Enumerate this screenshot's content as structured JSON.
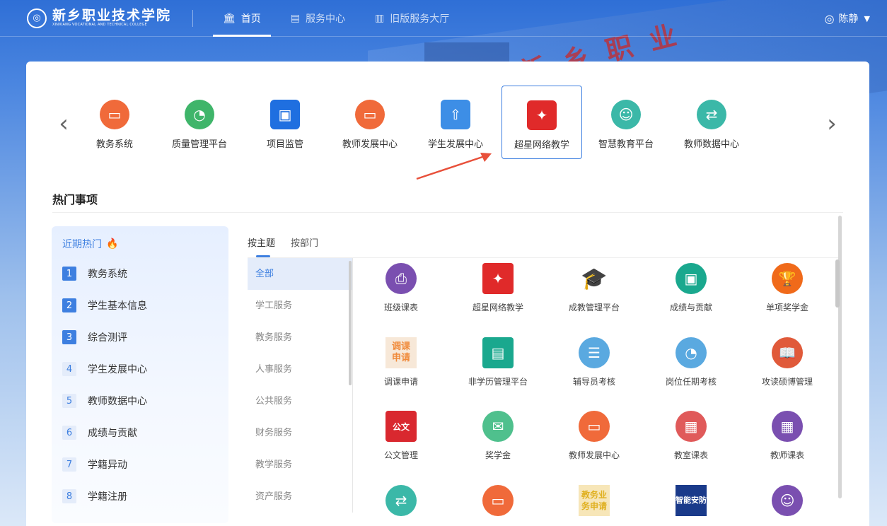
{
  "header": {
    "logo_cn": "新乡职业技术学院",
    "logo_en": "XINXIANG VOCATIONAL AND TECHNICAL COLLEGE",
    "nav": [
      {
        "label": "首页",
        "icon": "bank-icon"
      },
      {
        "label": "服务中心",
        "icon": "service-icon"
      },
      {
        "label": "旧版服务大厅",
        "icon": "document-icon"
      }
    ],
    "user_name": "陈静"
  },
  "background": {
    "sign_text": "新 乡 职 业"
  },
  "apps": [
    {
      "label": "教务系统",
      "color": "#f06a3a"
    },
    {
      "label": "质量管理平台",
      "color": "#3fb56a"
    },
    {
      "label": "项目监管",
      "color": "#1f6fe0"
    },
    {
      "label": "教师发展中心",
      "color": "#f06a3a"
    },
    {
      "label": "学生发展中心",
      "color": "#3d8ee6"
    },
    {
      "label": "超星网络教学",
      "color": "#e02a2a"
    },
    {
      "label": "智慧教育平台",
      "color": "#3bb8a8"
    },
    {
      "label": "教师数据中心",
      "color": "#3bb8a8"
    }
  ],
  "section_title": "热门事项",
  "hot": {
    "title": "近期热门",
    "items": [
      {
        "num": "1",
        "label": "教务系统"
      },
      {
        "num": "2",
        "label": "学生基本信息"
      },
      {
        "num": "3",
        "label": "综合测评"
      },
      {
        "num": "4",
        "label": "学生发展中心"
      },
      {
        "num": "5",
        "label": "教师数据中心"
      },
      {
        "num": "6",
        "label": "成绩与贡献"
      },
      {
        "num": "7",
        "label": "学籍异动"
      },
      {
        "num": "8",
        "label": "学籍注册"
      }
    ]
  },
  "tabs": [
    "按主题",
    "按部门"
  ],
  "categories": [
    "全部",
    "学工服务",
    "教务服务",
    "人事服务",
    "公共服务",
    "财务服务",
    "教学服务",
    "资产服务"
  ],
  "services": [
    {
      "label": "班级课表",
      "color": "#7a4fb0"
    },
    {
      "label": "超星网络教学",
      "color": "#e02a2a"
    },
    {
      "label": "成教管理平台",
      "color": "#d9282f"
    },
    {
      "label": "成绩与贡献",
      "color": "#1aa88e"
    },
    {
      "label": "单项奖学金",
      "color": "#f06a1a"
    },
    {
      "label": "调课申请",
      "color": "#f08a3a",
      "text": "调课\n申请"
    },
    {
      "label": "非学历管理平台",
      "color": "#1aa88e"
    },
    {
      "label": "辅导员考核",
      "color": "#5aa9e0"
    },
    {
      "label": "岗位任期考核",
      "color": "#5aa9e0"
    },
    {
      "label": "攻读硕博管理",
      "color": "#e05a3a"
    },
    {
      "label": "公文管理",
      "color": "#d9282f"
    },
    {
      "label": "奖学金",
      "color": "#4fc08d"
    },
    {
      "label": "教师发展中心",
      "color": "#f06a3a"
    },
    {
      "label": "教室课表",
      "color": "#e05a5a"
    },
    {
      "label": "教师课表",
      "color": "#7a4fb0"
    },
    {
      "label": "",
      "color": "#3bb8a8"
    },
    {
      "label": "",
      "color": "#f06a3a"
    },
    {
      "label": "",
      "color": "#f0c040",
      "text": "教务业\n务申请"
    },
    {
      "label": "",
      "color": "#1a3a8a",
      "text": "智能安防"
    },
    {
      "label": "",
      "color": "#7a4fb0"
    }
  ]
}
